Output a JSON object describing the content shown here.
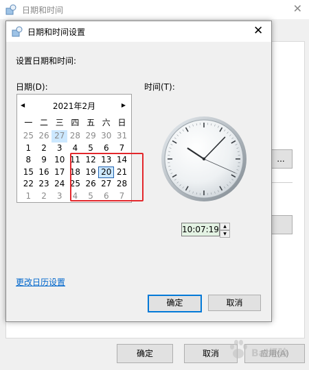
{
  "background_window": {
    "title": "日期和时间",
    "change_btn_label": "...",
    "ok_label": "确定",
    "cancel_label": "取消",
    "apply_label": "应用(A)"
  },
  "dialog": {
    "title": "日期和时间设置",
    "set_label": "设置日期和时间:",
    "date_label": "日期(D):",
    "time_label": "时间(T):",
    "calendar": {
      "month_label": "2021年2月",
      "weekdays": [
        "一",
        "二",
        "三",
        "四",
        "五",
        "六",
        "日"
      ],
      "days": [
        {
          "d": "25",
          "other": true
        },
        {
          "d": "26",
          "other": true
        },
        {
          "d": "27",
          "other": true,
          "shade": true
        },
        {
          "d": "28",
          "other": true
        },
        {
          "d": "29",
          "other": true
        },
        {
          "d": "30",
          "other": true
        },
        {
          "d": "31",
          "other": true
        },
        {
          "d": "1"
        },
        {
          "d": "2"
        },
        {
          "d": "3"
        },
        {
          "d": "4"
        },
        {
          "d": "5"
        },
        {
          "d": "6"
        },
        {
          "d": "7"
        },
        {
          "d": "8"
        },
        {
          "d": "9"
        },
        {
          "d": "10"
        },
        {
          "d": "11"
        },
        {
          "d": "12"
        },
        {
          "d": "13"
        },
        {
          "d": "14"
        },
        {
          "d": "15"
        },
        {
          "d": "16"
        },
        {
          "d": "17"
        },
        {
          "d": "18"
        },
        {
          "d": "19"
        },
        {
          "d": "20",
          "selected": true
        },
        {
          "d": "21"
        },
        {
          "d": "22"
        },
        {
          "d": "23"
        },
        {
          "d": "24"
        },
        {
          "d": "25"
        },
        {
          "d": "26"
        },
        {
          "d": "27"
        },
        {
          "d": "28"
        },
        {
          "d": "1",
          "other": true
        },
        {
          "d": "2",
          "other": true
        },
        {
          "d": "3",
          "other": true
        },
        {
          "d": "4",
          "other": true
        },
        {
          "d": "5",
          "other": true
        },
        {
          "d": "6",
          "other": true
        },
        {
          "d": "7",
          "other": true
        }
      ]
    },
    "time_value": "10:07:19",
    "clock": {
      "hour": 10,
      "minute": 7,
      "second": 19
    },
    "change_calendar_link": "更改日历设置",
    "ok_label": "确定",
    "cancel_label": "取消"
  },
  "watermark": {
    "text": "Bai经验"
  },
  "colors": {
    "annotation": "#e3262a",
    "link": "#0066cc",
    "selected": "#cce8ff",
    "focus": "#0078d7"
  }
}
